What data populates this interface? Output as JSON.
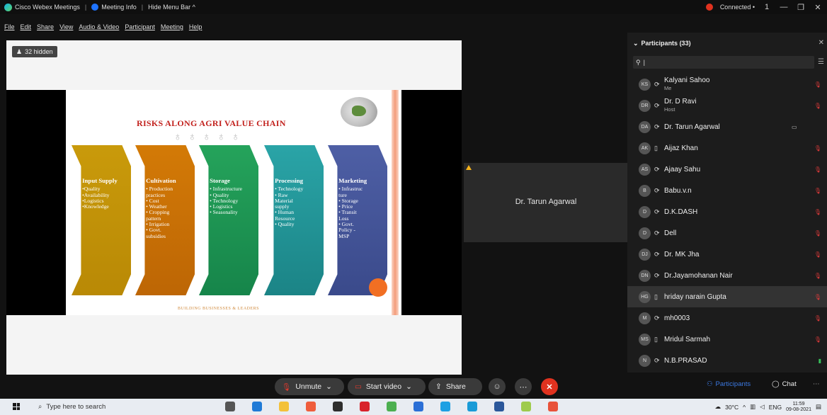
{
  "titlebar": {
    "app_name": "Cisco Webex Meetings",
    "meeting_info": "Meeting Info",
    "hide_menu": "Hide Menu Bar ^",
    "connection": "Connected •",
    "win_controls": [
      "1",
      "—",
      "❐",
      "✕"
    ]
  },
  "menubar": {
    "items": [
      "File",
      "Edit",
      "Share",
      "View",
      "Audio & Video",
      "Participant",
      "Meeting",
      "Help"
    ]
  },
  "stage": {
    "hidden_badge": "32 hidden",
    "slide": {
      "title": "RISKS ALONG AGRI VALUE CHAIN",
      "footer": "BUILDING BUSINESSES & LEADERS",
      "stages": [
        {
          "heading": "Input Supply",
          "items": [
            "•Quality",
            "•Availability",
            "•Logistics",
            "•Knowledge"
          ]
        },
        {
          "heading": "Cultivation",
          "items": [
            "• Production",
            "practices",
            "• Cost",
            "• Weather",
            "• Cropping",
            "pattern",
            "• Irrigation",
            "• Govt.",
            "subsidies"
          ]
        },
        {
          "heading": "Storage",
          "items": [
            "• Infrastructure",
            "• Quality",
            "• Technology",
            "• Logistics",
            "• Seasonality"
          ]
        },
        {
          "heading": "Processing",
          "items": [
            "• Technology",
            "• Raw",
            "Material",
            "supply",
            "• Human",
            "Resource",
            "• Quality"
          ]
        },
        {
          "heading": "Marketing",
          "items": [
            "• Infrastruc",
            "ture",
            "• Storage",
            "• Price",
            "• Transit",
            "Loss",
            "• Govt.",
            "Policy -",
            "MSP"
          ]
        }
      ]
    }
  },
  "video_tile": {
    "name": "Dr. Tarun Agarwal"
  },
  "participants": {
    "header": "Participants (33)",
    "search_value": "|",
    "list": [
      {
        "initials": "KS",
        "name": "Kalyani Sahoo",
        "sub": "Me",
        "device": "⟳",
        "mic": "muted"
      },
      {
        "initials": "DR",
        "name": "Dr. D Ravi",
        "sub": "Host",
        "device": "⟳",
        "mic": "muted"
      },
      {
        "initials": "DA",
        "name": "Dr. Tarun Agarwal",
        "sub": "",
        "device": "⟳",
        "mic": "none",
        "cam": "▭"
      },
      {
        "initials": "AK",
        "name": "Aijaz Khan",
        "sub": "",
        "device": "▯",
        "mic": "muted"
      },
      {
        "initials": "AS",
        "name": "Ajaay Sahu",
        "sub": "",
        "device": "⟳",
        "mic": "muted"
      },
      {
        "initials": "B",
        "name": "Babu.v.n",
        "sub": "",
        "device": "⟳",
        "mic": "muted"
      },
      {
        "initials": "D",
        "name": "D.K.DASH",
        "sub": "",
        "device": "⟳",
        "mic": "muted"
      },
      {
        "initials": "D",
        "name": "Dell",
        "sub": "",
        "device": "⟳",
        "mic": "muted"
      },
      {
        "initials": "DJ",
        "name": "Dr. MK Jha",
        "sub": "",
        "device": "⟳",
        "mic": "muted"
      },
      {
        "initials": "DN",
        "name": "Dr.Jayamohanan Nair",
        "sub": "",
        "device": "⟳",
        "mic": "muted"
      },
      {
        "initials": "HG",
        "name": "hriday narain Gupta",
        "sub": "",
        "device": "▯",
        "mic": "muted"
      },
      {
        "initials": "M",
        "name": "mh0003",
        "sub": "",
        "device": "⟳",
        "mic": "muted"
      },
      {
        "initials": "MS",
        "name": "Mridul Sarmah",
        "sub": "",
        "device": "▯",
        "mic": "muted"
      },
      {
        "initials": "N",
        "name": "N.B.PRASAD",
        "sub": "",
        "device": "⟳",
        "mic": "on"
      }
    ]
  },
  "controls": {
    "unmute": "Unmute",
    "start_video": "Start video",
    "share": "Share",
    "participants_tab": "Participants",
    "chat_tab": "Chat"
  },
  "taskbar": {
    "search_placeholder": "Type here to search",
    "temperature": "30°C",
    "language": "ENG",
    "time": "11:59",
    "date": "09-08-2021"
  },
  "colors": {
    "leave_red": "#e0321f",
    "slide_title_red": "#c2221e",
    "participants_tab_blue": "#3b78e0"
  }
}
